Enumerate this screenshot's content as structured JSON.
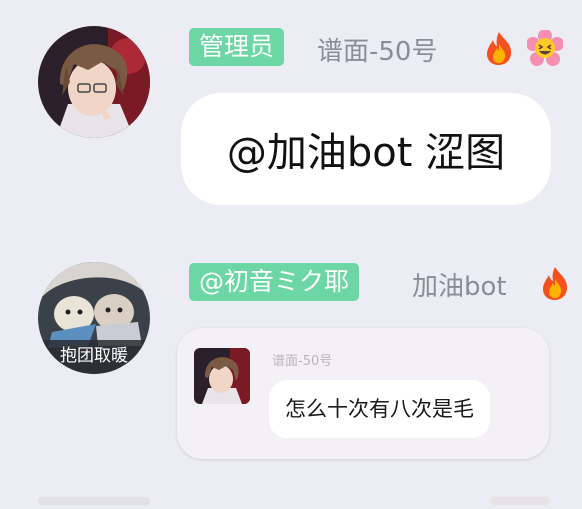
{
  "messages": [
    {
      "badge": "管理员",
      "nickname": "谱面-50号",
      "emojis": [
        "fire-emoji",
        "grinning-flower-emoji"
      ],
      "text": "@加油bot 涩图"
    },
    {
      "badge": "@初音ミク耶",
      "nickname": "加油bot",
      "emojis": [
        "fire-emoji"
      ],
      "avatar_caption": "抱团取暖",
      "quote": {
        "nickname": "谱面-50号",
        "text": "怎么十次有八次是毛"
      }
    }
  ],
  "colors": {
    "background": "#ececf4",
    "badge": "#6cd6a4",
    "bubble": "#ffffff",
    "quote_card": "#f4f1f6",
    "nickname": "#8a8d95"
  }
}
